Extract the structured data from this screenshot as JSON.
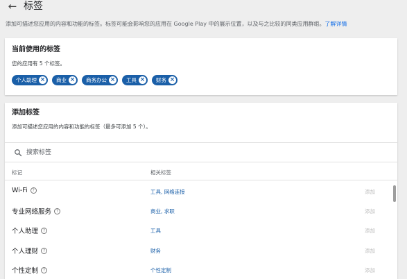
{
  "header": {
    "back_icon": "arrow-back-icon",
    "title": "标签"
  },
  "description": {
    "text": "添加可描述您应用的内容和功能的标签。标签可能会影响您的应用在 Google Play 中的展示位置，以及与之比较的同类应用群组。",
    "link": "了解详情"
  },
  "current_tags": {
    "title": "当前使用的标签",
    "count_text": "您的应用有 5 个标签。",
    "chips": [
      {
        "label": "个人助理"
      },
      {
        "label": "商业"
      },
      {
        "label": "商务办公"
      },
      {
        "label": "工具"
      },
      {
        "label": "财务"
      }
    ],
    "chip_color": "#1a5fa8"
  },
  "add_tags": {
    "title": "添加标签",
    "subtitle": "添加可描述您应用的内容和功能的标签（最多可添加 5 个）。",
    "search_placeholder": "搜索标签",
    "columns": {
      "tag": "标记",
      "related": "相关标签"
    },
    "rows": [
      {
        "name": "Wi-Fi",
        "related": "工具, 网络连接",
        "action": "添加"
      },
      {
        "name": "专业网络服务",
        "related": "商业, 求职",
        "action": "添加"
      },
      {
        "name": "个人助理",
        "related": "工具",
        "action": "添加"
      },
      {
        "name": "个人理财",
        "related": "财务",
        "action": "添加"
      },
      {
        "name": "个性定制",
        "related": "个性定制",
        "action": "添加"
      }
    ]
  }
}
